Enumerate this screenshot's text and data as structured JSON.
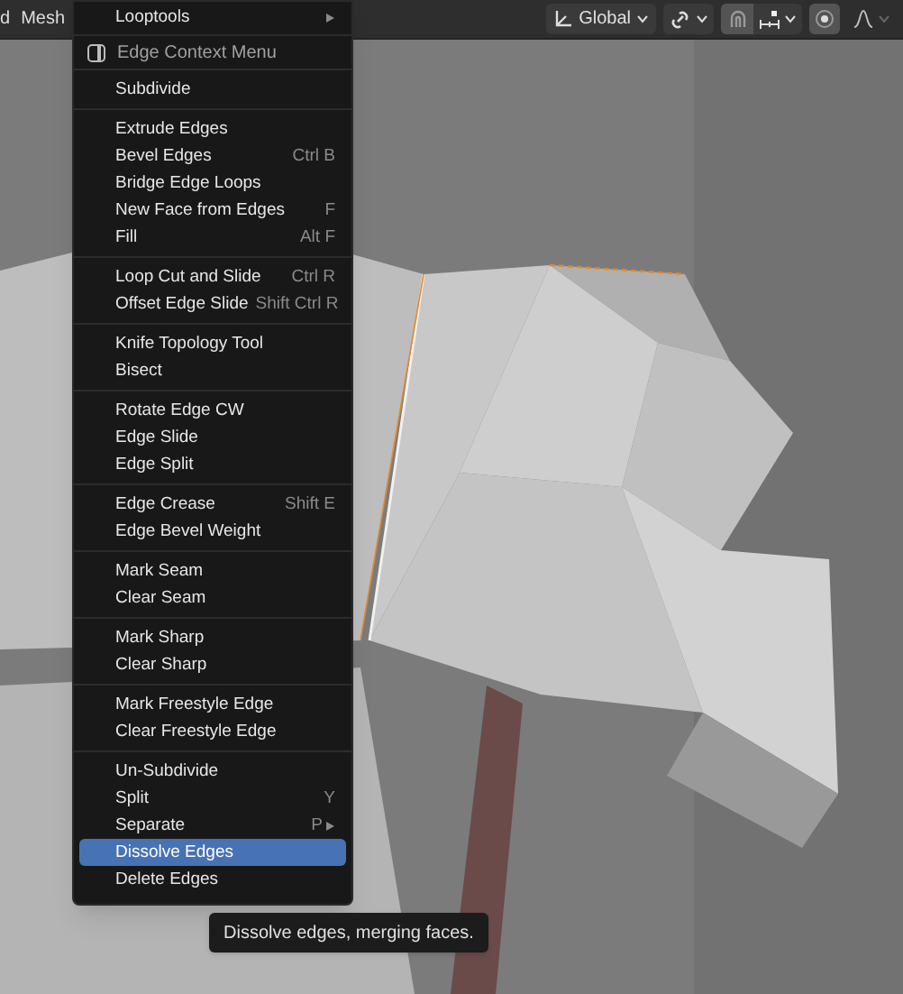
{
  "header": {
    "menus": [
      "d",
      "Mesh"
    ],
    "orientation": "Global"
  },
  "menu": {
    "title": "Edge Context Menu",
    "sections": [
      [
        {
          "label": "Looptools",
          "submenu": true,
          "selected": false
        }
      ],
      [
        {
          "label": "Subdivide",
          "submenu": false,
          "selected": false
        }
      ],
      [
        {
          "label": "Extrude Edges",
          "submenu": false,
          "selected": false
        },
        {
          "label": "Bevel Edges",
          "shortcut": "Ctrl B",
          "submenu": false,
          "selected": false
        },
        {
          "label": "Bridge Edge Loops",
          "submenu": false,
          "selected": false
        },
        {
          "label": "New Face from Edges",
          "shortcut": "F",
          "submenu": false,
          "selected": false
        },
        {
          "label": "Fill",
          "shortcut": "Alt F",
          "submenu": false,
          "selected": false
        }
      ],
      [
        {
          "label": "Loop Cut and Slide",
          "shortcut": "Ctrl R",
          "submenu": false,
          "selected": false
        },
        {
          "label": "Offset Edge Slide",
          "shortcut": "Shift Ctrl R",
          "submenu": false,
          "selected": false
        }
      ],
      [
        {
          "label": "Knife Topology Tool",
          "submenu": false,
          "selected": false
        },
        {
          "label": "Bisect",
          "submenu": false,
          "selected": false
        }
      ],
      [
        {
          "label": "Rotate Edge CW",
          "submenu": false,
          "selected": false
        },
        {
          "label": "Edge Slide",
          "submenu": false,
          "selected": false
        },
        {
          "label": "Edge Split",
          "submenu": false,
          "selected": false
        }
      ],
      [
        {
          "label": "Edge Crease",
          "shortcut": "Shift E",
          "submenu": false,
          "selected": false
        },
        {
          "label": "Edge Bevel Weight",
          "submenu": false,
          "selected": false
        }
      ],
      [
        {
          "label": "Mark Seam",
          "submenu": false,
          "selected": false
        },
        {
          "label": "Clear Seam",
          "submenu": false,
          "selected": false
        }
      ],
      [
        {
          "label": "Mark Sharp",
          "submenu": false,
          "selected": false
        },
        {
          "label": "Clear Sharp",
          "submenu": false,
          "selected": false
        }
      ],
      [
        {
          "label": "Mark Freestyle Edge",
          "submenu": false,
          "selected": false
        },
        {
          "label": "Clear Freestyle Edge",
          "submenu": false,
          "selected": false
        }
      ],
      [
        {
          "label": "Un-Subdivide",
          "submenu": false,
          "selected": false
        },
        {
          "label": "Split",
          "shortcut": "Y",
          "submenu": false,
          "selected": false
        },
        {
          "label": "Separate",
          "shortcut": "P",
          "submenu": true,
          "selected": false
        },
        {
          "label": "Dissolve Edges",
          "submenu": false,
          "selected": true
        },
        {
          "label": "Delete Edges",
          "submenu": false,
          "selected": false
        }
      ]
    ]
  },
  "tooltip": "Dissolve edges, merging faces."
}
